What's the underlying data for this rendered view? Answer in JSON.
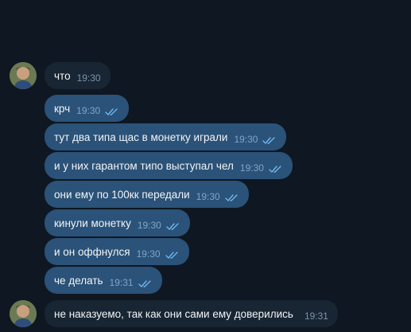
{
  "colors": {
    "background": "#0f1722",
    "incoming_bubble": "#182533",
    "outgoing_bubble": "#2b5278",
    "text": "#f2f4f6",
    "time": "#7fa6c8",
    "check": "#6fb6f0"
  },
  "messages": [
    {
      "text": "что",
      "time": "19:30",
      "read": false
    },
    {
      "text": "крч",
      "time": "19:30",
      "read": true
    },
    {
      "text": "тут два типа щас в монетку играли",
      "time": "19:30",
      "read": true
    },
    {
      "text": "и у них гарантом типо выступал чел",
      "time": "19:30",
      "read": true
    },
    {
      "text": "они ему по 100кк передали",
      "time": "19:30",
      "read": true
    },
    {
      "text": "кинули монетку",
      "time": "19:30",
      "read": true
    },
    {
      "text": "и он оффнулся",
      "time": "19:30",
      "read": true
    },
    {
      "text": "че делать",
      "time": "19:31",
      "read": true
    },
    {
      "text": "не наказуемо, так как они сами ему доверились",
      "time": "19:31",
      "read": false
    }
  ]
}
